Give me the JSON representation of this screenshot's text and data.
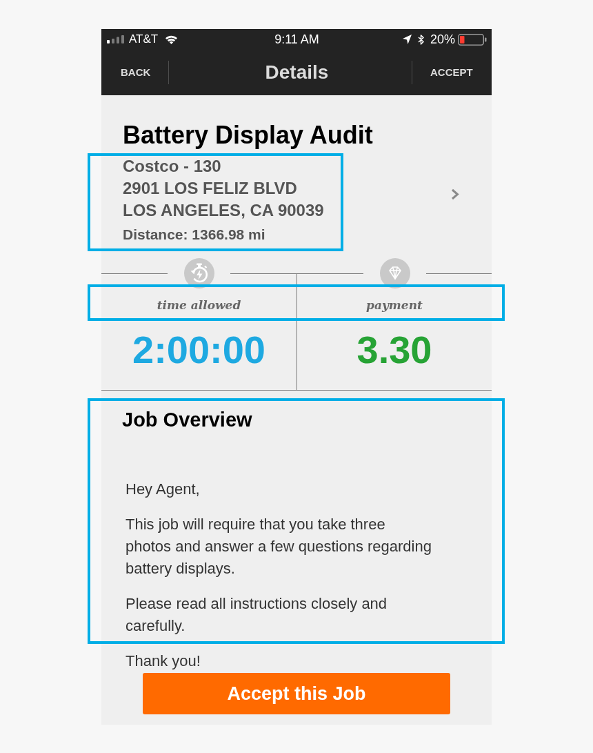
{
  "status_bar": {
    "carrier": "AT&T",
    "time": "9:11 AM",
    "battery": "20%"
  },
  "nav_bar": {
    "back": "BACK",
    "title": "Details",
    "accept": "ACCEPT"
  },
  "job": {
    "title": "Battery Display Audit"
  },
  "store": {
    "name": "Costco - 130",
    "address": [
      "2901 LOS FELIZ BLVD",
      "LOS ANGELES, CA 90039"
    ],
    "distance": "Distance: 1366.98 mi",
    "highlighted": true
  },
  "stats": {
    "highlighted": true,
    "items": [
      {
        "kind": "time",
        "label": "time allowed",
        "value": "2:00:00",
        "color": "#1ea9e1"
      },
      {
        "kind": "payment",
        "label": "payment",
        "value": "3.30",
        "color": "#27a335"
      }
    ]
  },
  "overview": {
    "title": "Job Overview",
    "highlighted": true,
    "paragraphs": [
      [
        "Hey Agent,"
      ],
      [
        "This job will require that you take three",
        "photos and answer a few questions regarding",
        "battery displays."
      ],
      [
        "Please read all instructions closely and",
        "carefully."
      ],
      [
        "Thank you!"
      ]
    ]
  },
  "accept_button": "Accept this Job"
}
